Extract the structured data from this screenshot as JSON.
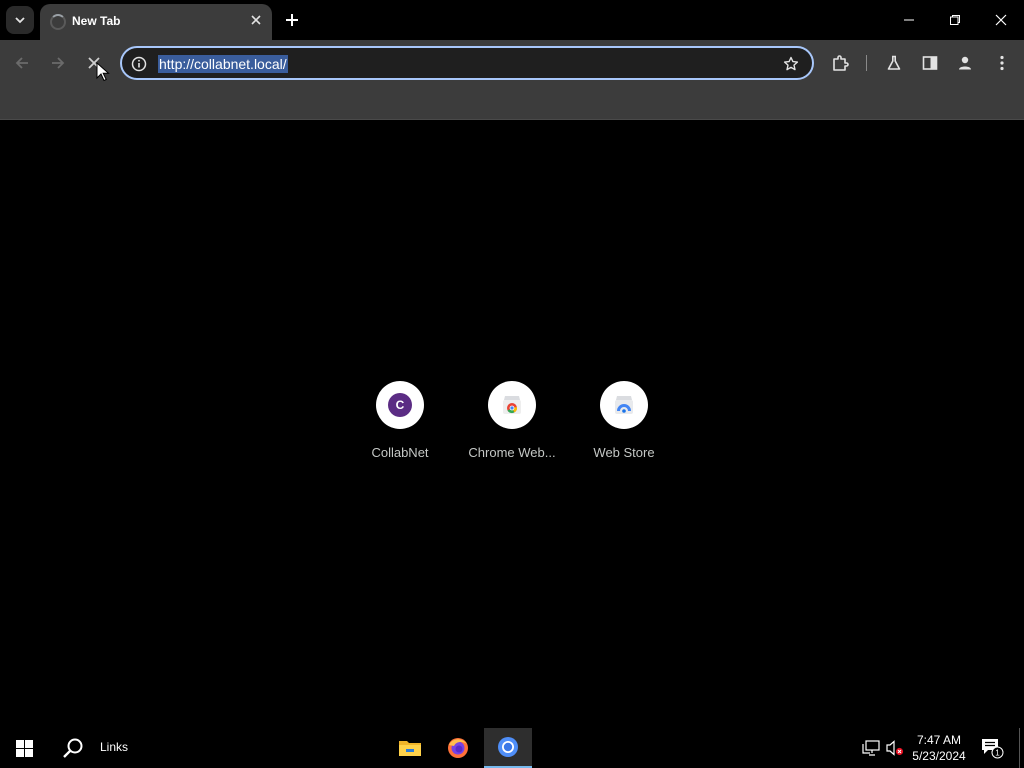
{
  "browser": {
    "tab": {
      "title": "New Tab"
    },
    "omnibox": {
      "url": "http://collabnet.local/"
    }
  },
  "shortcuts": [
    {
      "label": "CollabNet",
      "letter": "C",
      "icon": "collabnet-favicon"
    },
    {
      "label": "Chrome Web...",
      "icon": "chrome-web-store-icon"
    },
    {
      "label": "Web Store",
      "icon": "web-store-icon"
    }
  ],
  "taskbar": {
    "links_label": "Links",
    "apps": [
      "file-explorer-icon",
      "firefox-icon",
      "chrome-icon"
    ],
    "clock": {
      "time": "7:47 AM",
      "date": "5/23/2024"
    },
    "notification_count": "1"
  },
  "colors": {
    "omnibox_focus": "#a8c7fa",
    "url_selection": "#3a5d9c",
    "toolbar": "#3c3c3c",
    "collabnet_badge": "#5b2c84"
  }
}
